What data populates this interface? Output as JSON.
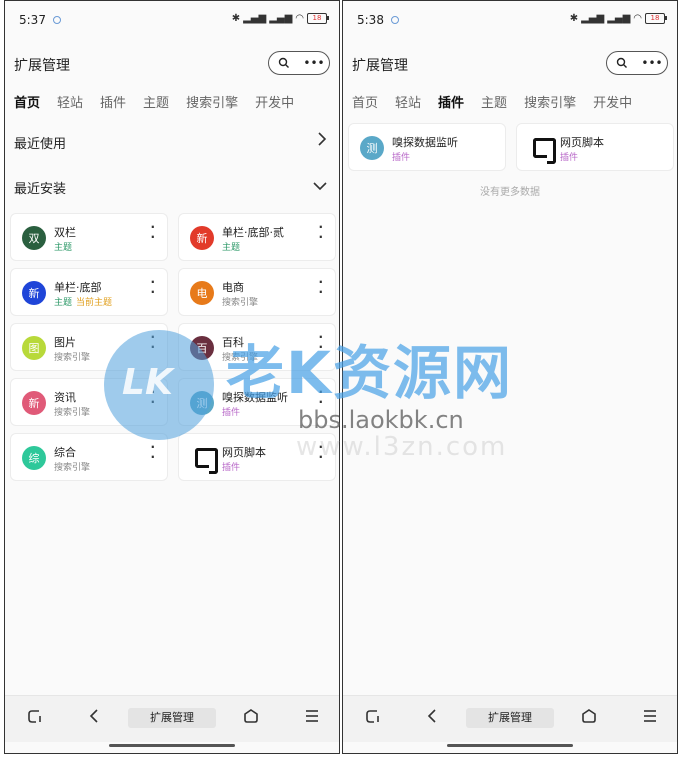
{
  "left": {
    "time": "5:37",
    "battery": "18",
    "title": "扩展管理",
    "search_icon": "search-icon",
    "more_icon": "more-icon",
    "tabs": [
      "首页",
      "轻站",
      "插件",
      "主题",
      "搜索引擎",
      "开发中"
    ],
    "active_tab": 0,
    "recent_used": "最近使用",
    "recent_installed": "最近安装",
    "cards": [
      {
        "name": "双栏",
        "avatar": "双",
        "type": "主题",
        "color": "#2a5f3f",
        "type_color": "#2f9a6a"
      },
      {
        "name": "单栏·底部·贰",
        "avatar": "新",
        "type": "主题",
        "color": "#e23a2a",
        "type_color": "#2f9a6a"
      },
      {
        "name": "单栏·底部",
        "avatar": "新",
        "type": "主题",
        "type_extra": "当前主题",
        "color": "#1f45d8",
        "type_color": "#2f9a6a",
        "extra_color": "#e0a020"
      },
      {
        "name": "电商",
        "avatar": "电",
        "type": "搜索引擎",
        "color": "#e77a1a",
        "type_color": "#888888"
      },
      {
        "name": "图片",
        "avatar": "图",
        "type": "搜索引擎",
        "color": "#b8d93a",
        "type_color": "#888888"
      },
      {
        "name": "百科",
        "avatar": "百",
        "type": "搜索引擎",
        "color": "#6a2f3f",
        "type_color": "#888888"
      },
      {
        "name": "资讯",
        "avatar": "新",
        "type": "搜索引擎",
        "color": "#e05a78",
        "type_color": "#888888"
      },
      {
        "name": "嗅探数据监听",
        "avatar": "测",
        "type": "插件",
        "color": "#5aa8c8",
        "type_color": "#b868c8"
      },
      {
        "name": "综合",
        "avatar": "综",
        "type": "搜索引擎",
        "color": "#2ec89a",
        "type_color": "#888888"
      },
      {
        "name": "网页脚本",
        "avatar": "",
        "type": "插件",
        "color": "#111111",
        "type_color": "#b868c8"
      }
    ],
    "nav_center": "扩展管理"
  },
  "right": {
    "time": "5:38",
    "battery": "18",
    "title": "扩展管理",
    "tabs": [
      "首页",
      "轻站",
      "插件",
      "主题",
      "搜索引擎",
      "开发中"
    ],
    "active_tab": 2,
    "cards": [
      {
        "name": "嗅探数据监听",
        "avatar": "测",
        "type": "插件",
        "color": "#5aa8c8",
        "type_color": "#b868c8"
      },
      {
        "name": "网页脚本",
        "avatar": "",
        "type": "插件",
        "color": "#111111",
        "type_color": "#b868c8"
      }
    ],
    "no_more": "没有更多数据",
    "nav_center": "扩展管理"
  },
  "watermark": {
    "logo_text": "LK",
    "title": "老K资源网",
    "url": "bbs.laokbk.cn",
    "url2": "www.l3zn.com"
  }
}
